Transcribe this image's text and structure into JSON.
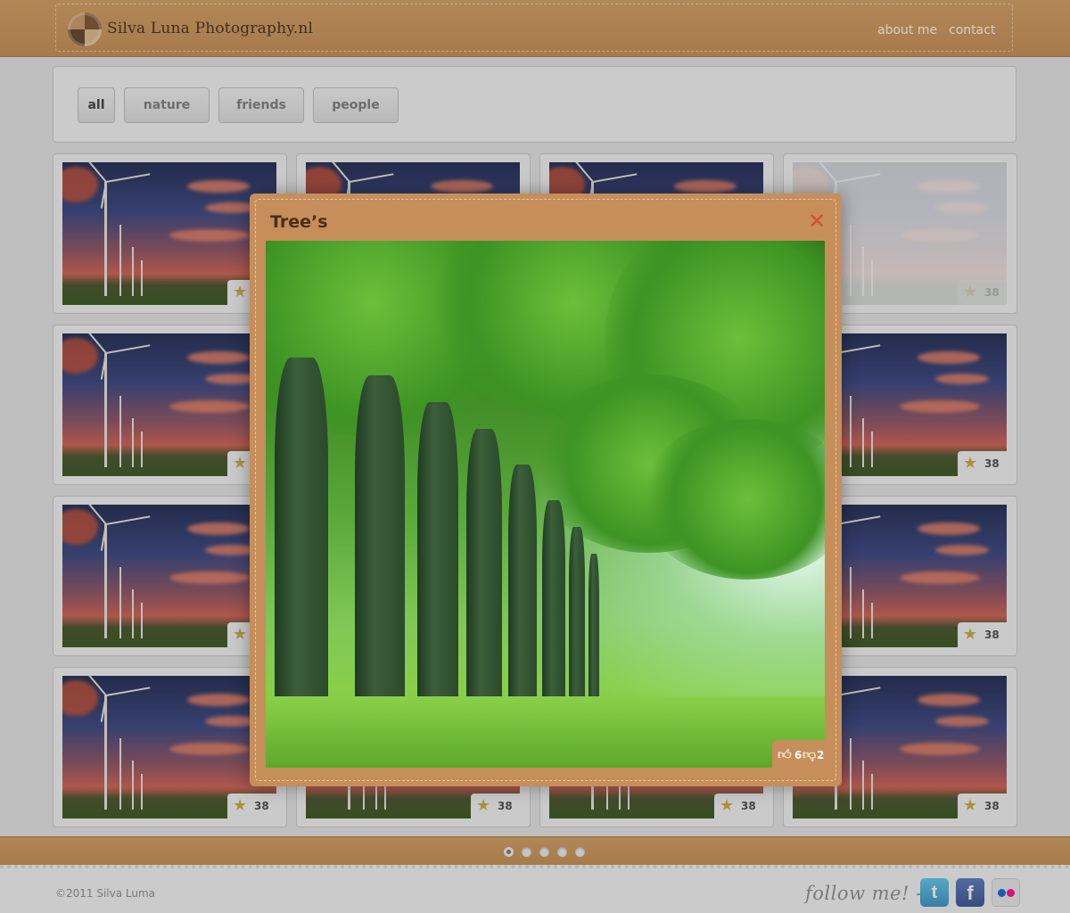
{
  "header": {
    "logo_text": "Silva Luna Photography.nl",
    "nav": [
      "about me",
      "contact"
    ]
  },
  "filters": [
    {
      "label": "all",
      "active": true
    },
    {
      "label": "nature",
      "active": false
    },
    {
      "label": "friends",
      "active": false
    },
    {
      "label": "people",
      "active": false
    }
  ],
  "gallery": {
    "rating_value": "38",
    "rating_icon": "star-icon"
  },
  "modal": {
    "title": "Tree’s",
    "close_icon": "close-icon",
    "likes": "6",
    "dislikes": "2"
  },
  "pagination": {
    "pages": 5,
    "current": 1
  },
  "footer": {
    "copyright": "©2011 Silva Luma",
    "follow_text": "follow me! ->",
    "social": [
      "twitter-icon",
      "facebook-icon",
      "flickr-icon"
    ]
  },
  "colors": {
    "brand": "#c58e5a",
    "close": "#d94a3a",
    "twitter": "#3fa9d6",
    "facebook": "#3b5998",
    "flickr_pink": "#ff0084",
    "flickr_blue": "#0063dc"
  }
}
